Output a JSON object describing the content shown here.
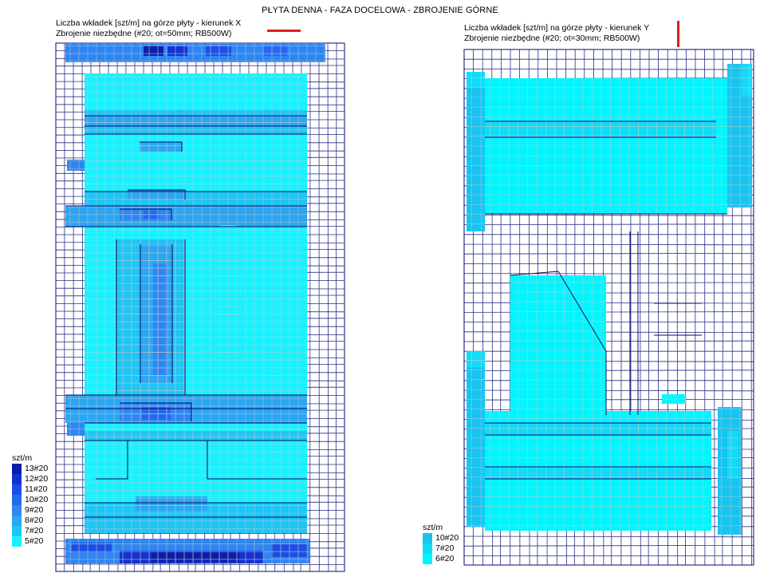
{
  "title": "PŁYTA DENNA - FAZA DOCELOWA - ZBROJENIE GÓRNE",
  "panels": {
    "x": {
      "caption_line1": "Liczba wkładek [szt/m] na górze płyty - kierunek X",
      "caption_line2": "Zbrojenie niezbędne (#20; ot=50mm; RB500W)",
      "legend_unit": "szt/m",
      "legend": [
        {
          "label": "13#20",
          "color": "#0a1ea8"
        },
        {
          "label": "12#20",
          "color": "#1232d2"
        },
        {
          "label": "11#20",
          "color": "#1a4ee6"
        },
        {
          "label": "10#20",
          "color": "#2468ee"
        },
        {
          "label": "9#20",
          "color": "#2e86f2"
        },
        {
          "label": "8#20",
          "color": "#2aa6f2"
        },
        {
          "label": "7#20",
          "color": "#1ec6f4"
        },
        {
          "label": "5#20",
          "color": "#18f2ff"
        }
      ]
    },
    "y": {
      "caption_line1": "Liczba wkładek [szt/m] na górze płyty - kierunek Y",
      "caption_line2": "Zbrojenie niezbędne (#20; ot=30mm; RB500W)",
      "legend_unit": "szt/m",
      "legend": [
        {
          "label": "10#20",
          "color": "#18c4f0"
        },
        {
          "label": "7#20",
          "color": "#10dcf8"
        },
        {
          "label": "6#20",
          "color": "#00f6ff"
        }
      ]
    }
  },
  "colors": {
    "mesh_line": "#000a6e",
    "inner_grid": "#c8c8d2",
    "direction_marker": "#e11c1c"
  }
}
